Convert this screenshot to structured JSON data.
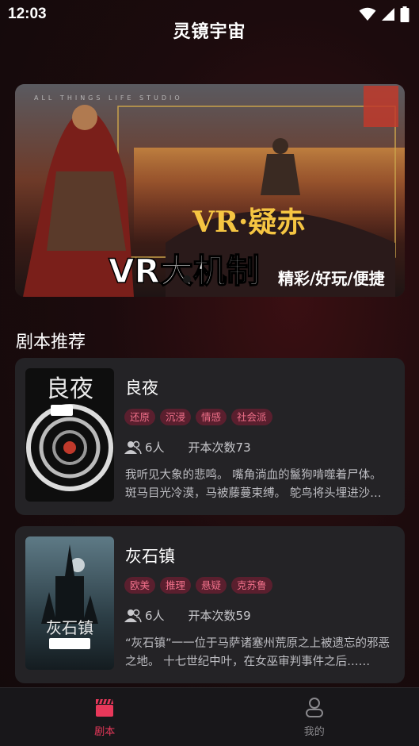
{
  "status_bar": {
    "time": "12:03"
  },
  "app": {
    "title": "灵镜宇宙"
  },
  "banner": {
    "headline": "VR大机制",
    "tagline": "精彩/好玩/便捷",
    "logo_text": "VR·疑赤",
    "studio_text": "ALL THINGS LIFE STUDIO"
  },
  "section": {
    "title": "剧本推荐"
  },
  "scripts": [
    {
      "title": "良夜",
      "tags": [
        "还原",
        "沉浸",
        "情感",
        "社会派"
      ],
      "people": "6人",
      "plays": "开本次数73",
      "description": "我听见大象的悲鸣。 嘴角淌血的鬣狗啃噬着尸体。 斑马目光冷漠，马被藤蔓束缚。 鸵鸟将头埋进沙里……",
      "cover_text": "良夜"
    },
    {
      "title": "灰石镇",
      "tags": [
        "欧美",
        "推理",
        "悬疑",
        "克苏鲁"
      ],
      "people": "6人",
      "plays": "开本次数59",
      "description": "“灰石镇”一一位于马萨诸塞州荒原之上被遗忘的邪恶之地。 十七世纪中叶，在女巫审判事件之后……",
      "cover_text": "灰石镇"
    }
  ],
  "nav": {
    "items": [
      {
        "label": "剧本",
        "icon": "clapperboard-icon",
        "active": true
      },
      {
        "label": "我的",
        "icon": "person-icon",
        "active": false
      }
    ]
  },
  "colors": {
    "accent": "#e8385a",
    "tag_bg": "#5a1f2e",
    "tag_text": "#f0708a",
    "card_bg": "#242326"
  }
}
